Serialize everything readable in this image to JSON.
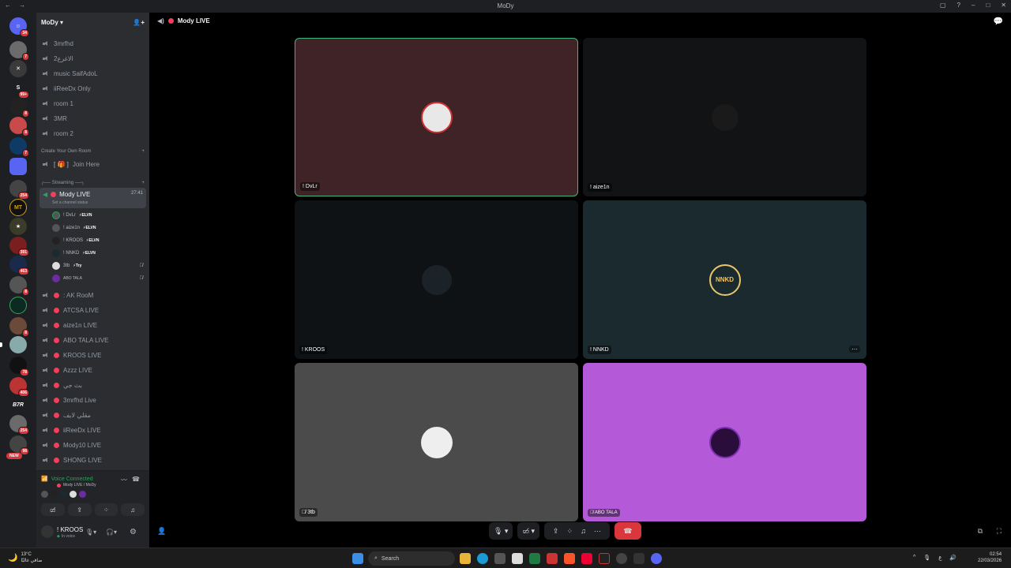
{
  "window": {
    "title": "MoDy"
  },
  "server_list": {
    "badges": [
      "34",
      "7",
      "99+",
      "8",
      "8",
      "7",
      "254",
      "391",
      "463",
      "8",
      "8",
      "78",
      "406",
      "254",
      "98"
    ],
    "new_label": "NEW",
    "labels": {
      "mt": "MT",
      "b7r": "B7R",
      "s": "S"
    }
  },
  "sidebar": {
    "server_name": "MoDy",
    "channels_top": [
      "3mrfhd",
      "الاغرع2",
      "music SaifAdoL",
      "iiReeDx Only",
      "room 1",
      "3MR",
      "room 2"
    ],
    "category_create": "Create Your Own Room",
    "join_here": "Join Here",
    "category_streaming": "Streaming",
    "active_channel": {
      "name": "Mody LIVE",
      "timer": "27:41",
      "status": "Set a channel status"
    },
    "members": [
      {
        "name": "! DvLr",
        "tag": "ELVN"
      },
      {
        "name": "! aize1n",
        "tag": "ELVN"
      },
      {
        "name": "! KROOS",
        "tag": "ELVN"
      },
      {
        "name": "! NNKD",
        "tag": "ELVN"
      },
      {
        "name": "3tb",
        "tag": "Try"
      },
      {
        "name": "ABO TALA",
        "tag": ""
      }
    ],
    "channels_live": [
      ": AK RooM",
      "ATCSA LIVE",
      "aize1n LIVE",
      "ABO TALA LIVE",
      "KROOS LIVE",
      "Azzz LIVE",
      "بث جي",
      "3mrfhd Live",
      "مقلي لايف",
      "iiReeDx LIVE",
      "Mody10 LIVE",
      "SHONG LIVE"
    ]
  },
  "voice": {
    "status": "Voice Connected",
    "location": "Mody LIVE / MoDy"
  },
  "user": {
    "name": "! KROOS",
    "status": "In voice"
  },
  "main": {
    "channel_title": "Mody LIVE",
    "tiles": [
      {
        "name": "! DvLr",
        "bg": "#3f2326"
      },
      {
        "name": "! aize1n",
        "bg": "#121314"
      },
      {
        "name": "! KROOS",
        "bg": "#0e1215"
      },
      {
        "name": "! NNKD",
        "bg": "#1b2a2e"
      },
      {
        "name": "3tb",
        "bg": "#4b4b4b"
      },
      {
        "name": "ABO TALA",
        "bg": "#b45ad9"
      }
    ],
    "nnkd_logo": "NNKD"
  },
  "taskbar": {
    "weather_temp": "13°C",
    "weather_desc": "صافي غالبًا",
    "search_label": "Search",
    "time": "02:54",
    "date": "22/03/2026",
    "lang": "ع"
  },
  "colors": {
    "accent_red": "#da373c",
    "live_pink": "#f23f5d",
    "voice_green": "#23a55a",
    "tile_border": "#43b581"
  }
}
